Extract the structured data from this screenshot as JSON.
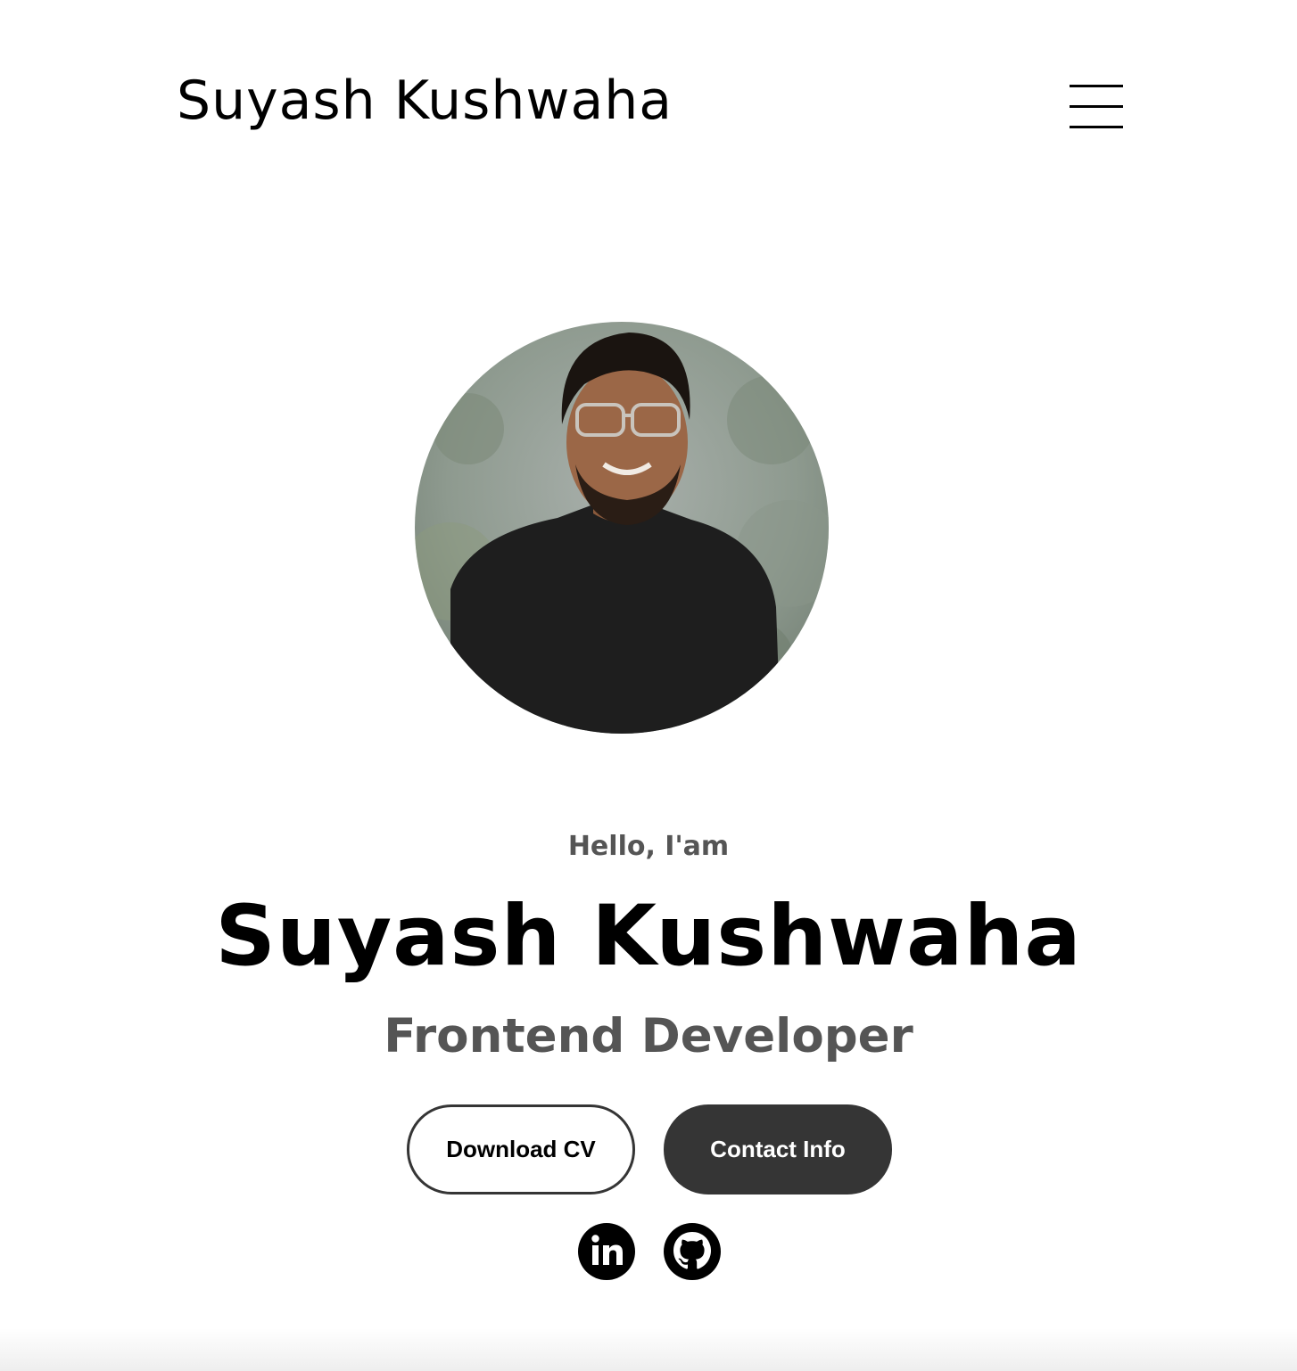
{
  "nav": {
    "logo": "Suyash Kushwaha",
    "menu_icon": "hamburger-menu-icon"
  },
  "profile": {
    "photo_icon": "profile-photo"
  },
  "hero": {
    "greeting": "Hello, I'am",
    "name": "Suyash Kushwaha",
    "role": "Frontend Developer"
  },
  "buttons": {
    "download_cv": "Download CV",
    "contact_info": "Contact Info"
  },
  "socials": {
    "linkedin_icon": "linkedin-icon",
    "github_icon": "github-icon"
  },
  "colors": {
    "text_primary": "#000000",
    "text_secondary": "#555555",
    "button_dark": "#353535",
    "background": "#ffffff"
  }
}
